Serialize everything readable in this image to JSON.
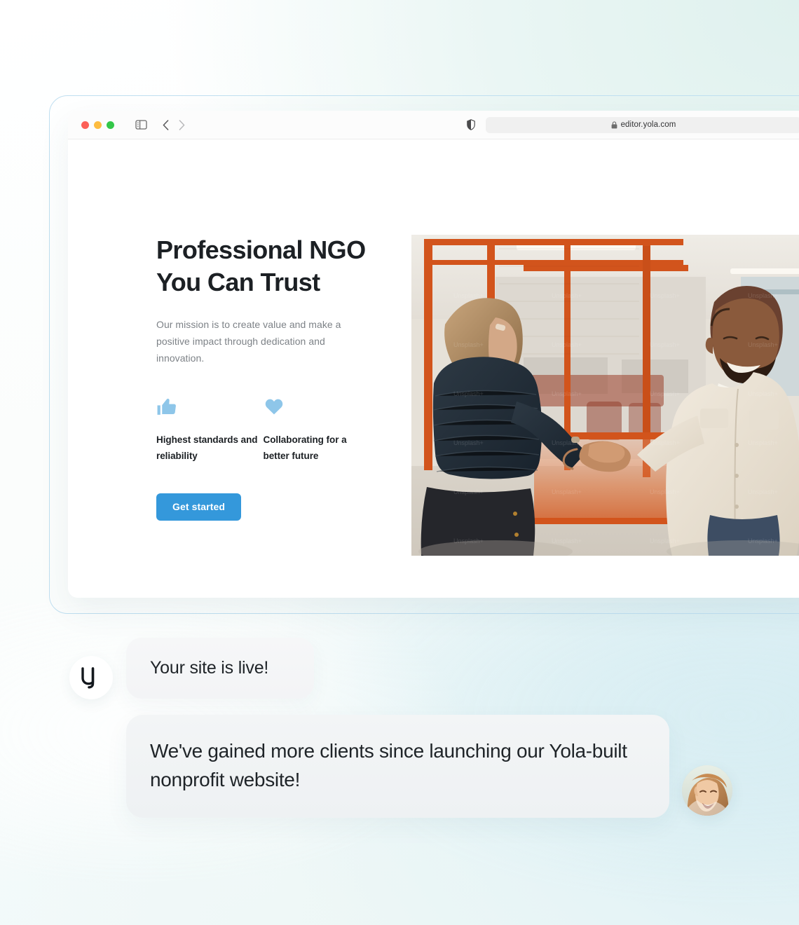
{
  "page": {
    "background_accent": "#e6f4f4"
  },
  "browser": {
    "window_controls": [
      {
        "name": "close",
        "color": "#fc6058"
      },
      {
        "name": "minimize",
        "color": "#fdbc40"
      },
      {
        "name": "zoom",
        "color": "#34c749"
      }
    ],
    "sidebar_icon": "sidebar-icon",
    "back_icon": "chevron-left-icon",
    "forward_icon": "chevron-right-icon",
    "shield_icon": "shield-icon",
    "lock_icon": "lock-icon",
    "reload_icon": "reload-icon",
    "url": "editor.yola.com"
  },
  "site": {
    "hero": {
      "title": "Professional NGO You Can Trust",
      "subtitle": "Our mission is to create value and make a positive impact through dedication and innovation.",
      "cta_label": "Get started",
      "cta_color": "#3498db",
      "features": [
        {
          "icon": "thumbs-up-icon",
          "label": "Highest standards and reliability",
          "icon_color": "#8ec6e9"
        },
        {
          "icon": "heart-icon",
          "label": "Collaborating for a better future",
          "icon_color": "#8ec6e9"
        }
      ],
      "image_alt": "Two people shaking hands in a modern office with orange glass partitions"
    }
  },
  "chat": {
    "brand_avatar_letter": "y",
    "messages": [
      {
        "sender": "yola",
        "text": "Your site is live!"
      },
      {
        "sender": "customer",
        "text": "We've gained more clients since launching our Yola-built nonprofit website!"
      }
    ],
    "customer_avatar_alt": "Smiling woman with wavy hair"
  }
}
